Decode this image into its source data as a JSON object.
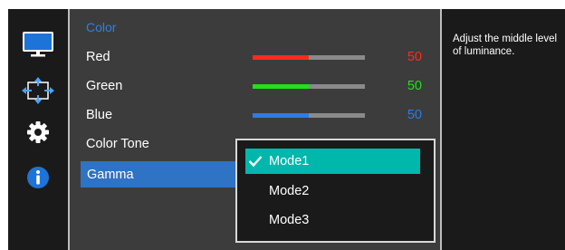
{
  "icons": {
    "picture": "monitor-icon",
    "display": "resize-arrows-icon",
    "system": "gear-icon",
    "information": "info-icon"
  },
  "menu": {
    "header": "Color",
    "items": {
      "red": {
        "label": "Red",
        "value": "50",
        "level": 0.5,
        "color": "#ff2a1a"
      },
      "green": {
        "label": "Green",
        "value": "50",
        "level": 0.5,
        "color": "#22e01a"
      },
      "blue": {
        "label": "Blue",
        "value": "50",
        "level": 0.5,
        "color": "#2a7de8"
      },
      "color_tone": {
        "label": "Color Tone"
      },
      "gamma": {
        "label": "Gamma"
      }
    }
  },
  "gamma_dropdown": {
    "selected": "Mode1",
    "options": [
      "Mode1",
      "Mode2",
      "Mode3"
    ]
  },
  "help": {
    "line1": "Adjust the middle level",
    "line2": "of luminance."
  },
  "colors": {
    "header": "#2f7fe0",
    "selected_row": "#2f73c4",
    "selected_option": "#00b7ab"
  }
}
